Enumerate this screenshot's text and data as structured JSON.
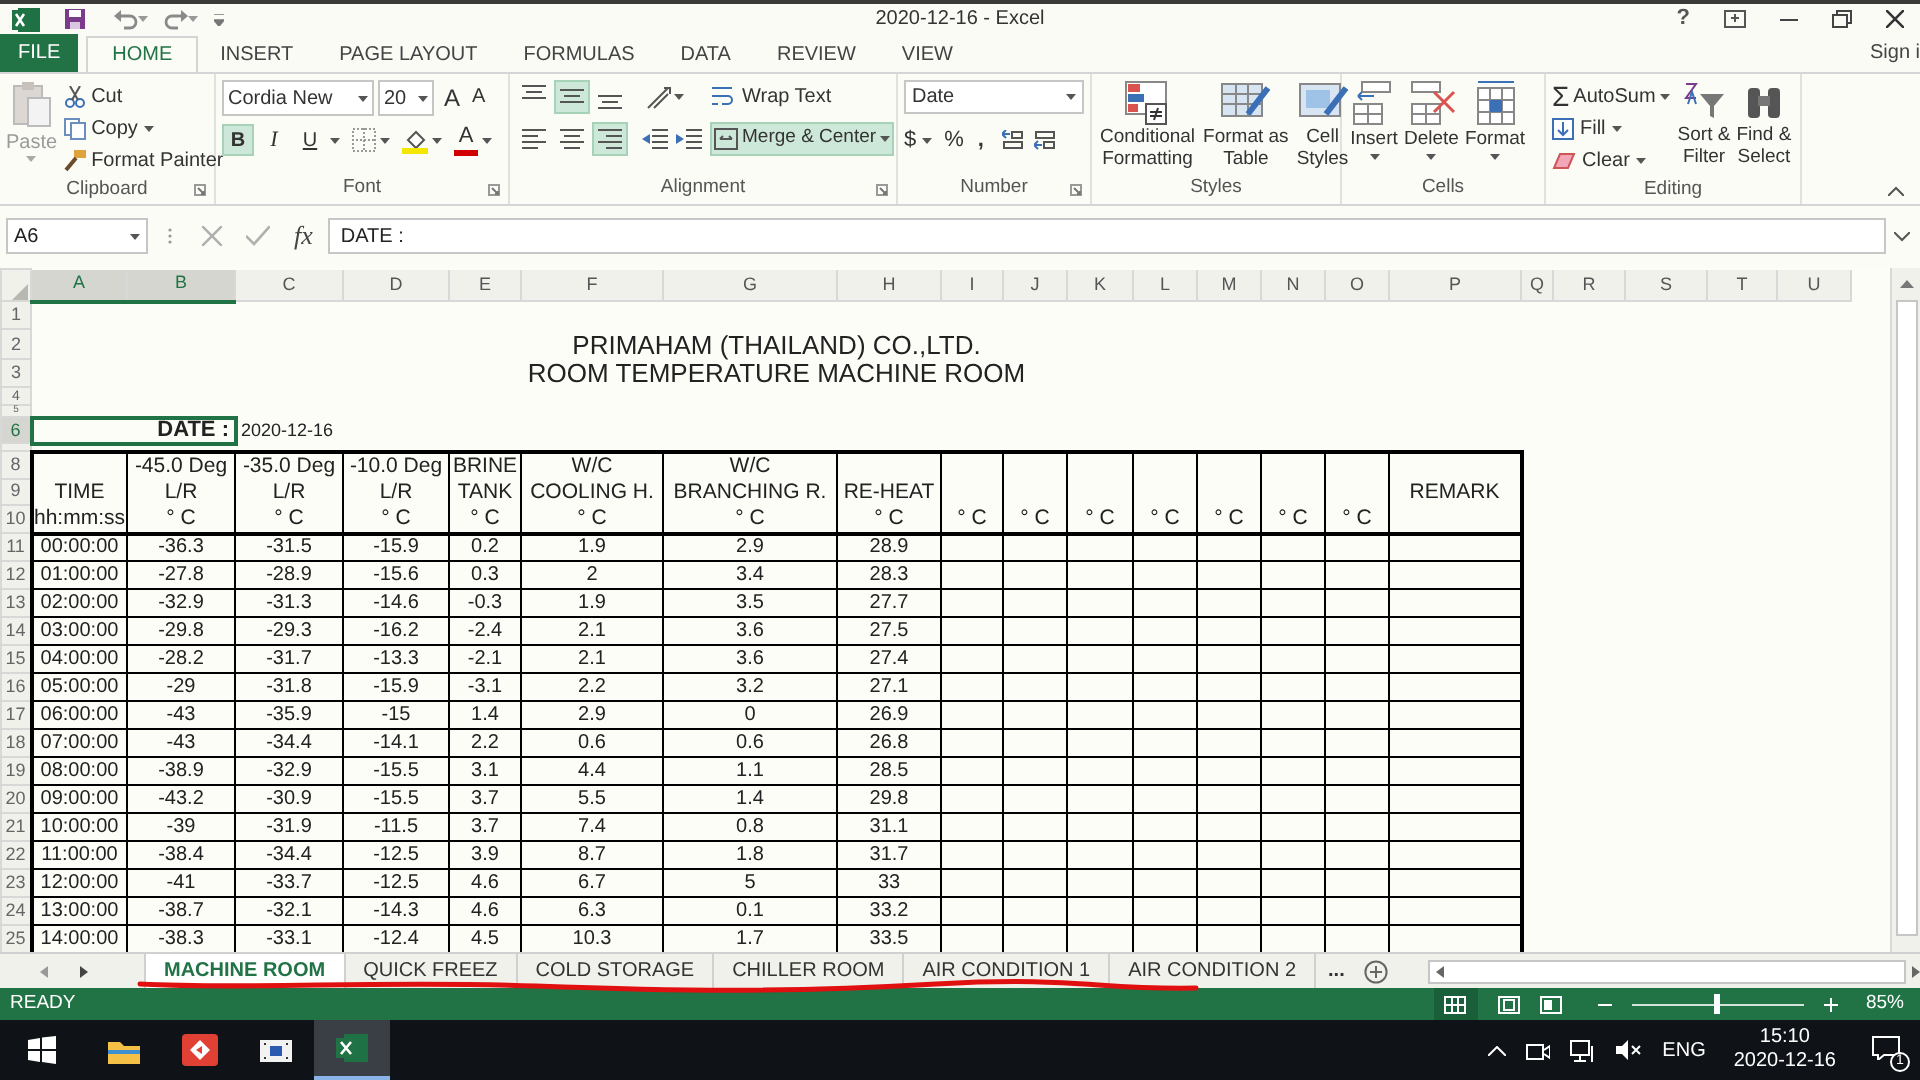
{
  "window": {
    "title": "2020-12-16 - Excel",
    "help": "?"
  },
  "ribbon_tabs": [
    {
      "label": "FILE",
      "kind": "file",
      "selected": false
    },
    {
      "label": "HOME",
      "kind": "tab",
      "selected": true
    },
    {
      "label": "INSERT",
      "kind": "tab",
      "selected": false
    },
    {
      "label": "PAGE LAYOUT",
      "kind": "tab",
      "selected": false
    },
    {
      "label": "FORMULAS",
      "kind": "tab",
      "selected": false
    },
    {
      "label": "DATA",
      "kind": "tab",
      "selected": false
    },
    {
      "label": "REVIEW",
      "kind": "tab",
      "selected": false
    },
    {
      "label": "VIEW",
      "kind": "tab",
      "selected": false
    }
  ],
  "account": "Sign i",
  "ribbon": {
    "clipboard": {
      "label": "Clipboard",
      "paste": {
        "label": "Paste",
        "disabled": true
      },
      "cut": "Cut",
      "copy": "Copy",
      "format_painter": "Format Painter"
    },
    "font": {
      "label": "Font",
      "family": "Cordia New",
      "size": "20",
      "grow": "A",
      "shrink": "A",
      "bold": {
        "glyph": "B",
        "on": true
      },
      "italic": {
        "glyph": "I",
        "on": false
      },
      "underline": {
        "glyph": "U",
        "on": false
      },
      "color_glyph": "A"
    },
    "alignment": {
      "label": "Alignment",
      "vertical": [
        {
          "kind": "top",
          "on": false
        },
        {
          "kind": "middle",
          "on": true
        },
        {
          "kind": "bottom",
          "on": false
        }
      ],
      "horizontal": [
        {
          "kind": "left",
          "on": false
        },
        {
          "kind": "center",
          "on": false
        },
        {
          "kind": "right",
          "on": true
        }
      ],
      "wrap_text": {
        "label": "Wrap Text",
        "on": false
      },
      "merge": {
        "label": "Merge & Center",
        "on": true
      }
    },
    "number": {
      "label": "Number",
      "format": "Date",
      "currency": "$",
      "percent": "%",
      "comma": ","
    },
    "styles": {
      "label": "Styles",
      "buttons": [
        {
          "kind": "conditional",
          "lines": [
            "Conditional",
            "Formatting"
          ]
        },
        {
          "kind": "table",
          "lines": [
            "Format as",
            "Table"
          ]
        },
        {
          "kind": "cellstyles",
          "lines": [
            "Cell",
            "Styles"
          ]
        }
      ]
    },
    "cells": {
      "label": "Cells",
      "buttons": [
        {
          "kind": "insert",
          "label": "Insert"
        },
        {
          "kind": "delete",
          "label": "Delete"
        },
        {
          "kind": "format",
          "label": "Format"
        }
      ]
    },
    "editing": {
      "label": "Editing",
      "autosum_glyph": "Σ",
      "autosum": "AutoSum",
      "fill": "Fill",
      "clear": "Clear",
      "sort": [
        "Sort &",
        "Filter"
      ],
      "find": [
        "Find &",
        "Select"
      ]
    }
  },
  "formula_bar": {
    "name_box": "A6",
    "fx": "fx",
    "value": "DATE :"
  },
  "sheet": {
    "columns": [
      {
        "label": "A",
        "selected": true
      },
      {
        "label": "B",
        "selected": true
      },
      {
        "label": "C",
        "selected": false
      },
      {
        "label": "D",
        "selected": false
      },
      {
        "label": "E",
        "selected": false
      },
      {
        "label": "F",
        "selected": false
      },
      {
        "label": "G",
        "selected": false
      },
      {
        "label": "H",
        "selected": false
      },
      {
        "label": "I",
        "selected": false
      },
      {
        "label": "J",
        "selected": false
      },
      {
        "label": "K",
        "selected": false
      },
      {
        "label": "L",
        "selected": false
      },
      {
        "label": "M",
        "selected": false
      },
      {
        "label": "N",
        "selected": false
      },
      {
        "label": "O",
        "selected": false
      },
      {
        "label": "P",
        "selected": false
      },
      {
        "label": "Q",
        "selected": false
      },
      {
        "label": "R",
        "selected": false
      },
      {
        "label": "S",
        "selected": false
      },
      {
        "label": "T",
        "selected": false
      },
      {
        "label": "U",
        "selected": false
      }
    ],
    "top_rows": [
      {
        "number": "1",
        "selected": false
      },
      {
        "number": "2",
        "selected": false
      },
      {
        "number": "3",
        "selected": false
      },
      {
        "number": "4",
        "selected": false
      },
      {
        "number": "5",
        "selected": false
      },
      {
        "number": "6",
        "selected": true
      }
    ],
    "header_rows": [
      {
        "number": "8",
        "selected": false
      },
      {
        "number": "9",
        "selected": false
      },
      {
        "number": "10",
        "selected": false
      }
    ],
    "title_lines": [
      "PRIMAHAM (THAILAND) CO.,LTD.",
      "ROOM TEMPERATURE MACHINE ROOM"
    ],
    "date_label": "DATE :",
    "date_value": "2020-12-16",
    "headers": [
      [
        "TIME",
        "hh:mm:ss"
      ],
      [
        "-45.0 Deg",
        "L/R",
        "° C"
      ],
      [
        "-35.0 Deg",
        "L/R",
        "° C"
      ],
      [
        "-10.0 Deg",
        "L/R",
        "° C"
      ],
      [
        "BRINE",
        "TANK",
        "° C"
      ],
      [
        "W/C",
        "COOLING H.",
        "° C"
      ],
      [
        "W/C",
        "BRANCHING R.",
        "° C"
      ],
      [
        "RE-HEAT",
        "° C"
      ],
      [
        "° C"
      ],
      [
        "° C"
      ],
      [
        "° C"
      ],
      [
        "° C"
      ],
      [
        "° C"
      ],
      [
        "° C"
      ],
      [
        "° C"
      ],
      [
        "REMARK"
      ]
    ],
    "rows": [
      {
        "number": "11",
        "cells": [
          "00:00:00",
          "-36.3",
          "-31.5",
          "-15.9",
          "0.2",
          "1.9",
          "2.9",
          "28.9"
        ]
      },
      {
        "number": "12",
        "cells": [
          "01:00:00",
          "-27.8",
          "-28.9",
          "-15.6",
          "0.3",
          "2",
          "3.4",
          "28.3"
        ]
      },
      {
        "number": "13",
        "cells": [
          "02:00:00",
          "-32.9",
          "-31.3",
          "-14.6",
          "-0.3",
          "1.9",
          "3.5",
          "27.7"
        ]
      },
      {
        "number": "14",
        "cells": [
          "03:00:00",
          "-29.8",
          "-29.3",
          "-16.2",
          "-2.4",
          "2.1",
          "3.6",
          "27.5"
        ]
      },
      {
        "number": "15",
        "cells": [
          "04:00:00",
          "-28.2",
          "-31.7",
          "-13.3",
          "-2.1",
          "2.1",
          "3.6",
          "27.4"
        ]
      },
      {
        "number": "16",
        "cells": [
          "05:00:00",
          "-29",
          "-31.8",
          "-15.9",
          "-3.1",
          "2.2",
          "3.2",
          "27.1"
        ]
      },
      {
        "number": "17",
        "cells": [
          "06:00:00",
          "-43",
          "-35.9",
          "-15",
          "1.4",
          "2.9",
          "0",
          "26.9"
        ]
      },
      {
        "number": "18",
        "cells": [
          "07:00:00",
          "-43",
          "-34.4",
          "-14.1",
          "2.2",
          "0.6",
          "0.6",
          "26.8"
        ]
      },
      {
        "number": "19",
        "cells": [
          "08:00:00",
          "-38.9",
          "-32.9",
          "-15.5",
          "3.1",
          "4.4",
          "1.1",
          "28.5"
        ]
      },
      {
        "number": "20",
        "cells": [
          "09:00:00",
          "-43.2",
          "-30.9",
          "-15.5",
          "3.7",
          "5.5",
          "1.4",
          "29.8"
        ]
      },
      {
        "number": "21",
        "cells": [
          "10:00:00",
          "-39",
          "-31.9",
          "-11.5",
          "3.7",
          "7.4",
          "0.8",
          "31.1"
        ]
      },
      {
        "number": "22",
        "cells": [
          "11:00:00",
          "-38.4",
          "-34.4",
          "-12.5",
          "3.9",
          "8.7",
          "1.8",
          "31.7"
        ]
      },
      {
        "number": "23",
        "cells": [
          "12:00:00",
          "-41",
          "-33.7",
          "-12.5",
          "4.6",
          "6.7",
          "5",
          "33"
        ]
      },
      {
        "number": "24",
        "cells": [
          "13:00:00",
          "-38.7",
          "-32.1",
          "-14.3",
          "4.6",
          "6.3",
          "0.1",
          "33.2"
        ]
      },
      {
        "number": "25",
        "cells": [
          "14:00:00",
          "-38.3",
          "-33.1",
          "-12.4",
          "4.5",
          "10.3",
          "1.7",
          "33.5"
        ]
      }
    ]
  },
  "sheet_tabs": [
    {
      "label": "MACHINE ROOM",
      "selected": true
    },
    {
      "label": "QUICK FREEZ",
      "selected": false
    },
    {
      "label": "COLD STORAGE",
      "selected": false
    },
    {
      "label": "CHILLER ROOM",
      "selected": false
    },
    {
      "label": "AIR CONDITION 1",
      "selected": false
    },
    {
      "label": "AIR CONDITION 2",
      "selected": false
    }
  ],
  "more_tabs": "...",
  "status_bar": {
    "status": "READY",
    "zoom": "85%",
    "level": 0.5
  },
  "taskbar": {
    "apps": [
      {
        "kind": "explorer",
        "active": false
      },
      {
        "kind": "remote",
        "active": false
      },
      {
        "kind": "media",
        "active": false
      },
      {
        "kind": "excel",
        "active": true
      }
    ],
    "language": "ENG",
    "time": "15:10",
    "date": "2020-12-16",
    "notifications": "1"
  }
}
